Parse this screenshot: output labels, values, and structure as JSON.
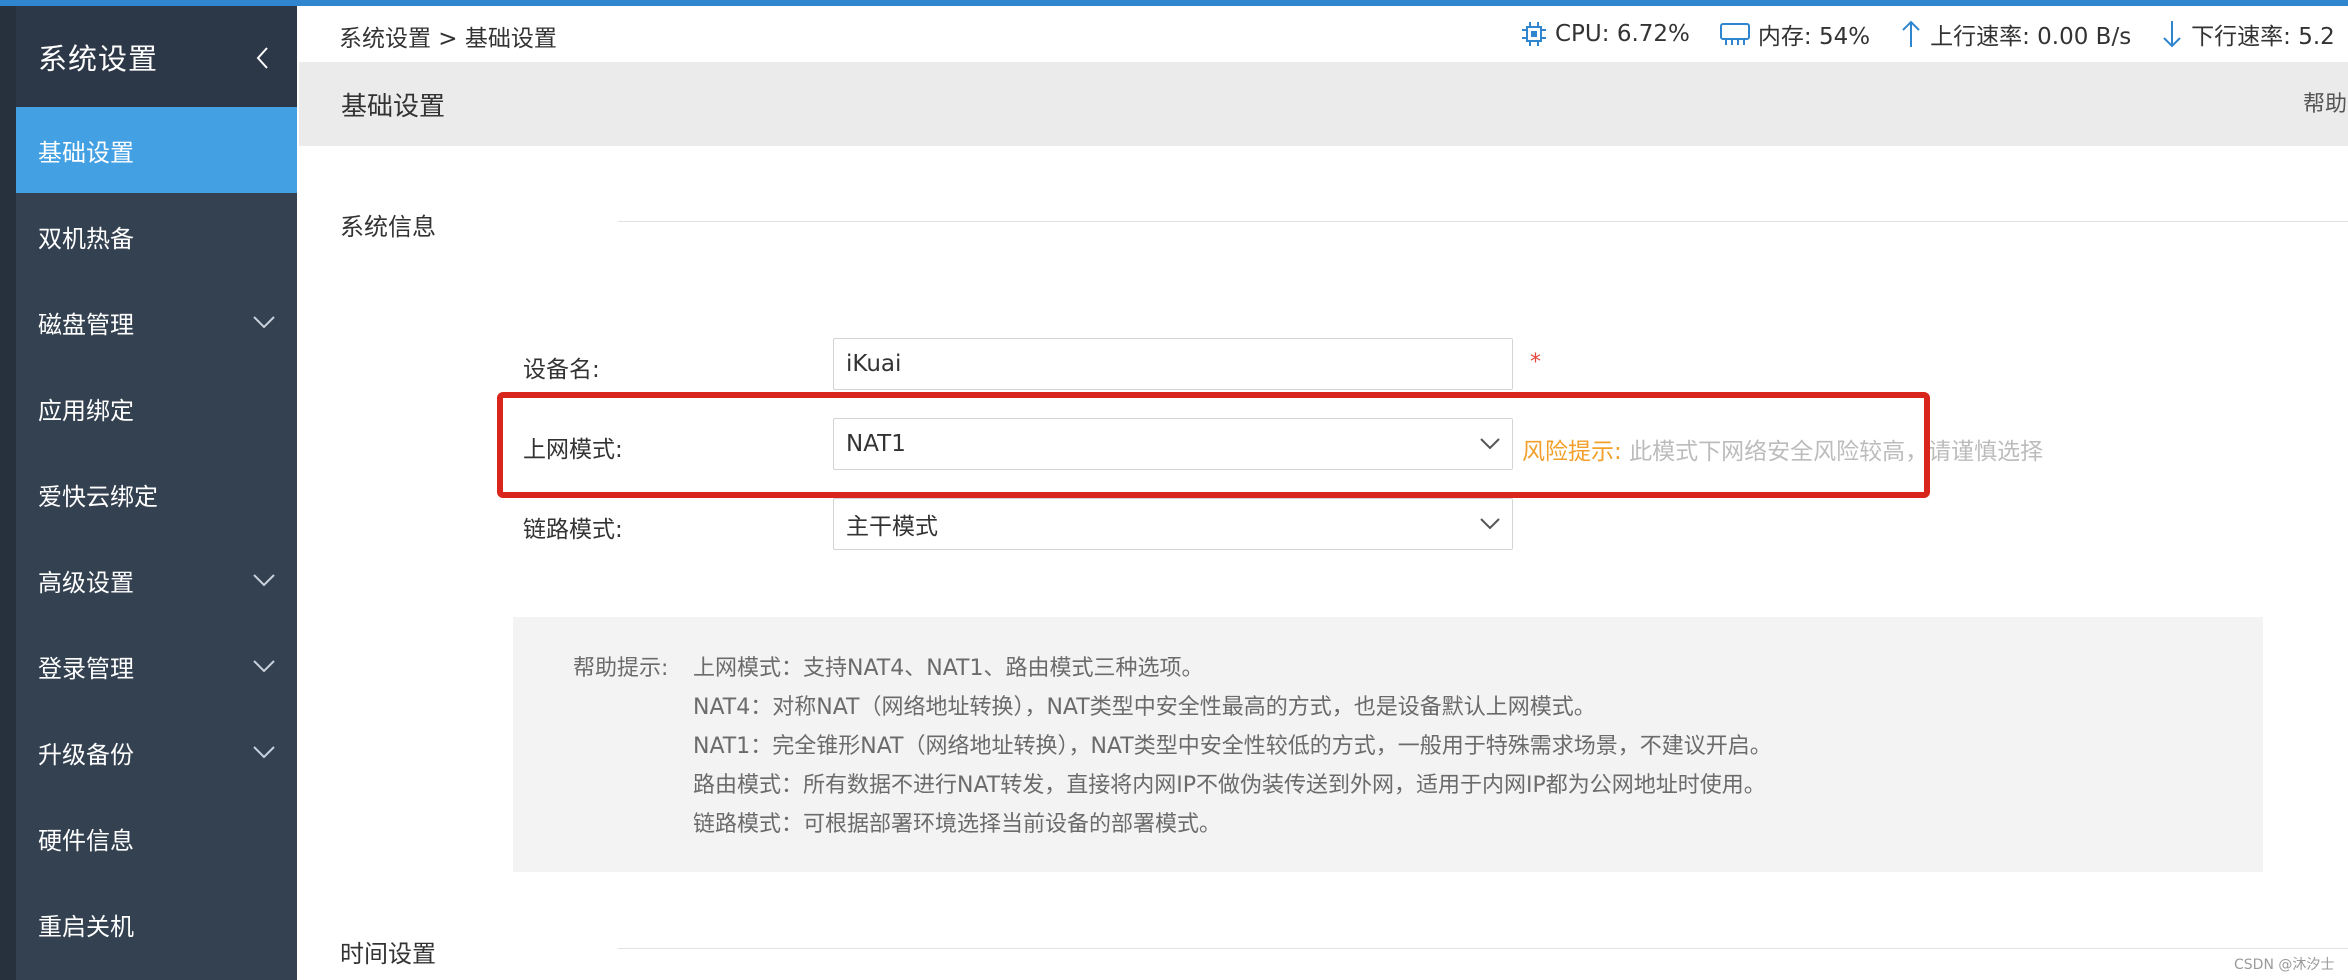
{
  "sidebar": {
    "title": "系统设置",
    "items": [
      {
        "label": "基础设置"
      },
      {
        "label": "双机热备"
      },
      {
        "label": "磁盘管理"
      },
      {
        "label": "应用绑定"
      },
      {
        "label": "爱快云绑定"
      },
      {
        "label": "高级设置"
      },
      {
        "label": "登录管理"
      },
      {
        "label": "升级备份"
      },
      {
        "label": "硬件信息"
      },
      {
        "label": "重启关机"
      }
    ]
  },
  "topbar": {
    "breadcrumb": "系统设置 > 基础设置",
    "cpu": "CPU: 6.72%",
    "memory": "内存: 54%",
    "upload": "上行速率: 0.00 B/s",
    "download": "下行速率: 5.2"
  },
  "page": {
    "title": "基础设置",
    "help": "帮助"
  },
  "system_info": {
    "section_title": "系统信息",
    "device_name_label": "设备名:",
    "device_name_value": "iKuai",
    "required": "*",
    "internet_mode_label": "上网模式:",
    "internet_mode_value": "NAT1",
    "risk_label": "风险提示:",
    "risk_text": "此模式下网络安全风险较高，请谨慎选择",
    "link_mode_label": "链路模式:",
    "link_mode_value": "主干模式"
  },
  "help_panel": {
    "prefix": "帮助提示:",
    "lines": [
      "上网模式：支持NAT4、NAT1、路由模式三种选项。",
      "NAT4：对称NAT（网络地址转换），NAT类型中安全性最高的方式，也是设备默认上网模式。",
      "NAT1：完全锥形NAT（网络地址转换），NAT类型中安全性较低的方式，一般用于特殊需求场景，不建议开启。",
      "路由模式：所有数据不进行NAT转发，直接将内网IP不做伪装传送到外网，适用于内网IP都为公网地址时使用。",
      "链路模式：可根据部署环境选择当前设备的部署模式。"
    ]
  },
  "time_settings": {
    "section_title": "时间设置"
  },
  "watermark": "CSDN @沐汐士",
  "colors": {
    "accent": "#2f86cf",
    "sidebar_bg": "#344150",
    "active_item": "#42a0e3",
    "highlight": "#d9261c",
    "risk": "#f2a02b",
    "required": "#e6483d"
  },
  "icons": [
    "collapse-left-icon",
    "chevron-down-icon",
    "cpu-icon",
    "memory-icon",
    "upload-arrow-icon",
    "download-arrow-icon"
  ]
}
